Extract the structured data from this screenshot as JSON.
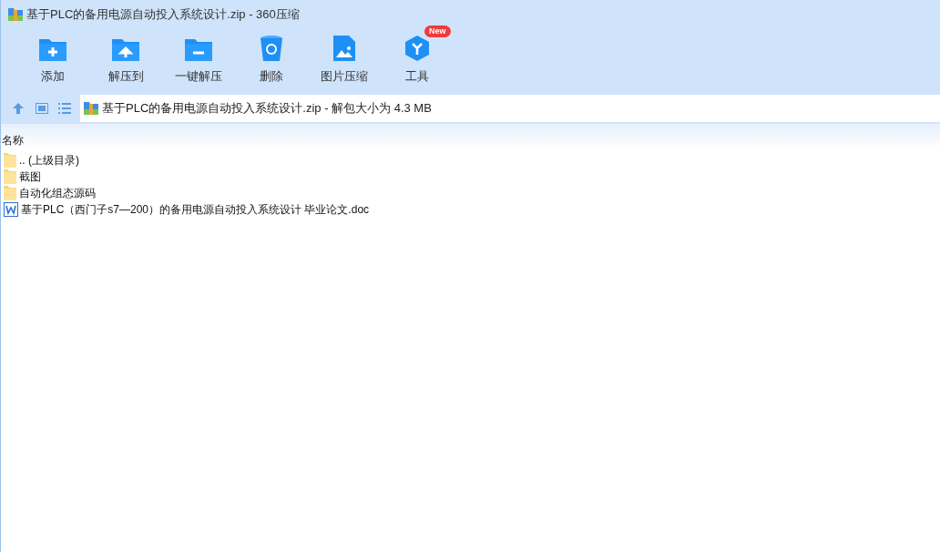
{
  "window": {
    "title": "基于PLC的备用电源自动投入系统设计.zip - 360压缩"
  },
  "toolbar": [
    {
      "kind": "add",
      "label": "添加"
    },
    {
      "kind": "extract",
      "label": "解压到"
    },
    {
      "kind": "quick",
      "label": "一键解压"
    },
    {
      "kind": "delete",
      "label": "删除"
    },
    {
      "kind": "image",
      "label": "图片压缩"
    },
    {
      "kind": "tools",
      "label": "工具",
      "badge": "New"
    }
  ],
  "address_bar": {
    "text": "基于PLC的备用电源自动投入系统设计.zip - 解包大小为 4.3 MB"
  },
  "table": {
    "columns": [
      "名称"
    ],
    "rows": [
      {
        "kind": "folder",
        "name": ".. (上级目录)"
      },
      {
        "kind": "folder",
        "name": "截图"
      },
      {
        "kind": "folder",
        "name": "自动化组态源码"
      },
      {
        "kind": "doc",
        "name": "基于PLC（西门子s7—200）的备用电源自动投入系统设计 毕业论文.doc"
      }
    ]
  }
}
